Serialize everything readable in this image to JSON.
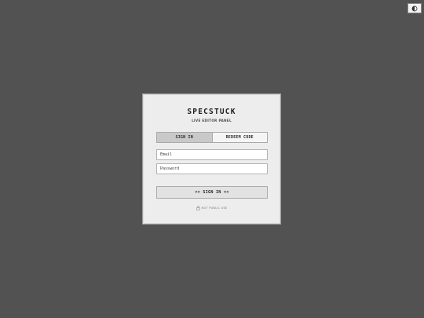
{
  "app": {
    "brand": "SPECSTUCK",
    "subtitle": "LIVE EDITOR PANEL"
  },
  "header": {
    "theme_toggle_icon": "half-moon-icon"
  },
  "tabs": [
    {
      "label": "SIGN IN",
      "active": true
    },
    {
      "label": "REDEEM CODE",
      "active": false
    }
  ],
  "form": {
    "email_placeholder": "Email",
    "email_value": "",
    "password_placeholder": "Password",
    "password_value": "",
    "submit_label": ">> SIGN IN <<"
  },
  "footer": {
    "lock_icon": "lock-icon",
    "note": "NOT PUBLIC USE"
  },
  "colors": {
    "background": "#525252",
    "panel": "#ededed",
    "active_tab": "#c9c9c9"
  }
}
